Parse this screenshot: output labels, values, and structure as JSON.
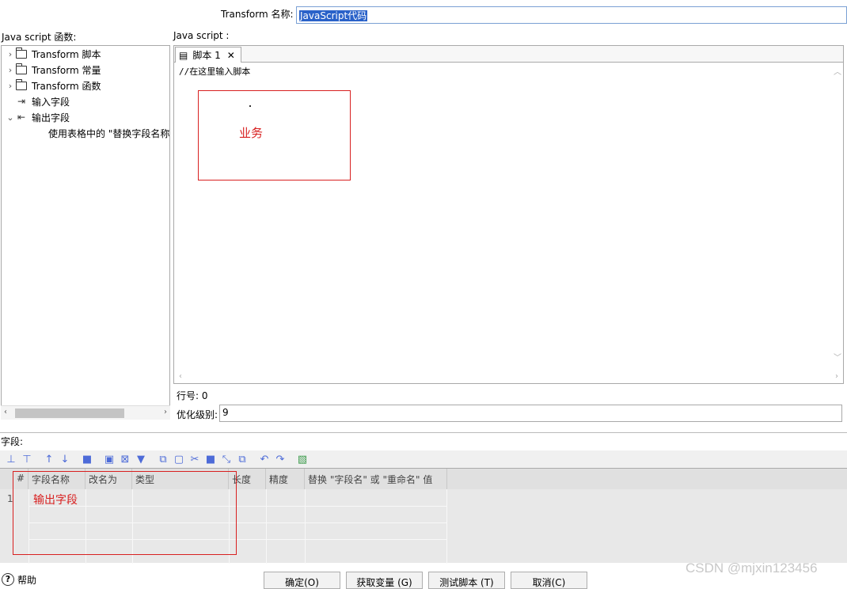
{
  "transform": {
    "name_label": "Transform 名称:",
    "name_value": "JavaScript代码"
  },
  "tree": {
    "label": "Java script 函数:",
    "items": [
      {
        "label": "Transform 脚本"
      },
      {
        "label": "Transform 常量"
      },
      {
        "label": "Transform 函数"
      },
      {
        "label": "输入字段"
      },
      {
        "label": "输出字段"
      },
      {
        "label": "使用表格中的 \"替换字段名称"
      }
    ]
  },
  "script": {
    "label": "Java script :",
    "tab_label": "脚本 1",
    "code": "//在这里输入脚本",
    "annotation": "业务"
  },
  "status": {
    "line_label": "行号: 0",
    "opt_label": "优化级别:",
    "opt_value": "9"
  },
  "fields": {
    "label": "字段:",
    "columns": [
      "#",
      "字段名称",
      "改名为",
      "类型",
      "长度",
      "精度",
      "替换 \"字段名\" 或 \"重命名\" 值"
    ],
    "rows": [
      {
        "num": "1",
        "name": "输出字段"
      }
    ]
  },
  "buttons": {
    "help": "帮助",
    "ok": "确定(O)",
    "get_vars": "获取变量 (G)",
    "test": "测试脚本 (T)",
    "cancel": "取消(C)"
  },
  "watermark": "CSDN @mjxin123456",
  "colors": {
    "accent": "#2a62c9",
    "annotation_red": "#d82020",
    "toolbar_icon": "#4d6bd8"
  }
}
